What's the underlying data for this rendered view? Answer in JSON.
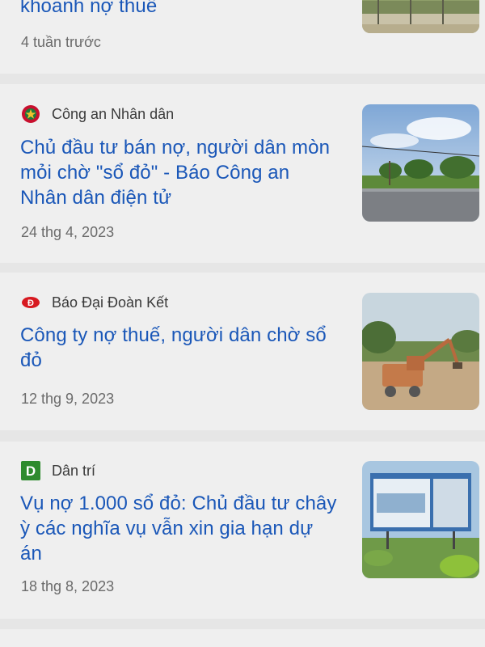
{
  "articles": [
    {
      "source": "",
      "title": "khoanh nợ thuế",
      "time": "4 tuần trước",
      "logo_icon": "none",
      "thumb_icon": "field-road-image"
    },
    {
      "source": "Công an Nhân dân",
      "title_lines": [
        "Chủ đầu tư bán nợ, người dân mòn",
        "mỏi chờ \"sổ đỏ\" - Báo Công an",
        "Nhân dân điện tử"
      ],
      "time": "24 thg 4, 2023",
      "logo_icon": "cand-emblem-icon",
      "thumb_icon": "road-trees-image"
    },
    {
      "source": "Báo Đại Đoàn Kết",
      "title_lines": [
        "Công ty nợ thuế, người dân chờ sổ",
        "đỏ"
      ],
      "time": "12 thg 9, 2023",
      "logo_icon": "dai-doan-ket-logo-icon",
      "thumb_icon": "excavator-image"
    },
    {
      "source": "Dân trí",
      "title_lines": [
        "Vụ nợ 1.000 sổ đỏ: Chủ đầu tư chây",
        "ỳ các nghĩa vụ vẫn xin gia hạn dự",
        "án"
      ],
      "time": "18 thg 8, 2023",
      "logo_icon": "dan-tri-logo-icon",
      "thumb_icon": "project-billboard-image"
    }
  ],
  "colors": {
    "headline": "#1a57b8",
    "card": "#efefef",
    "divider": "#e6e6e6"
  }
}
